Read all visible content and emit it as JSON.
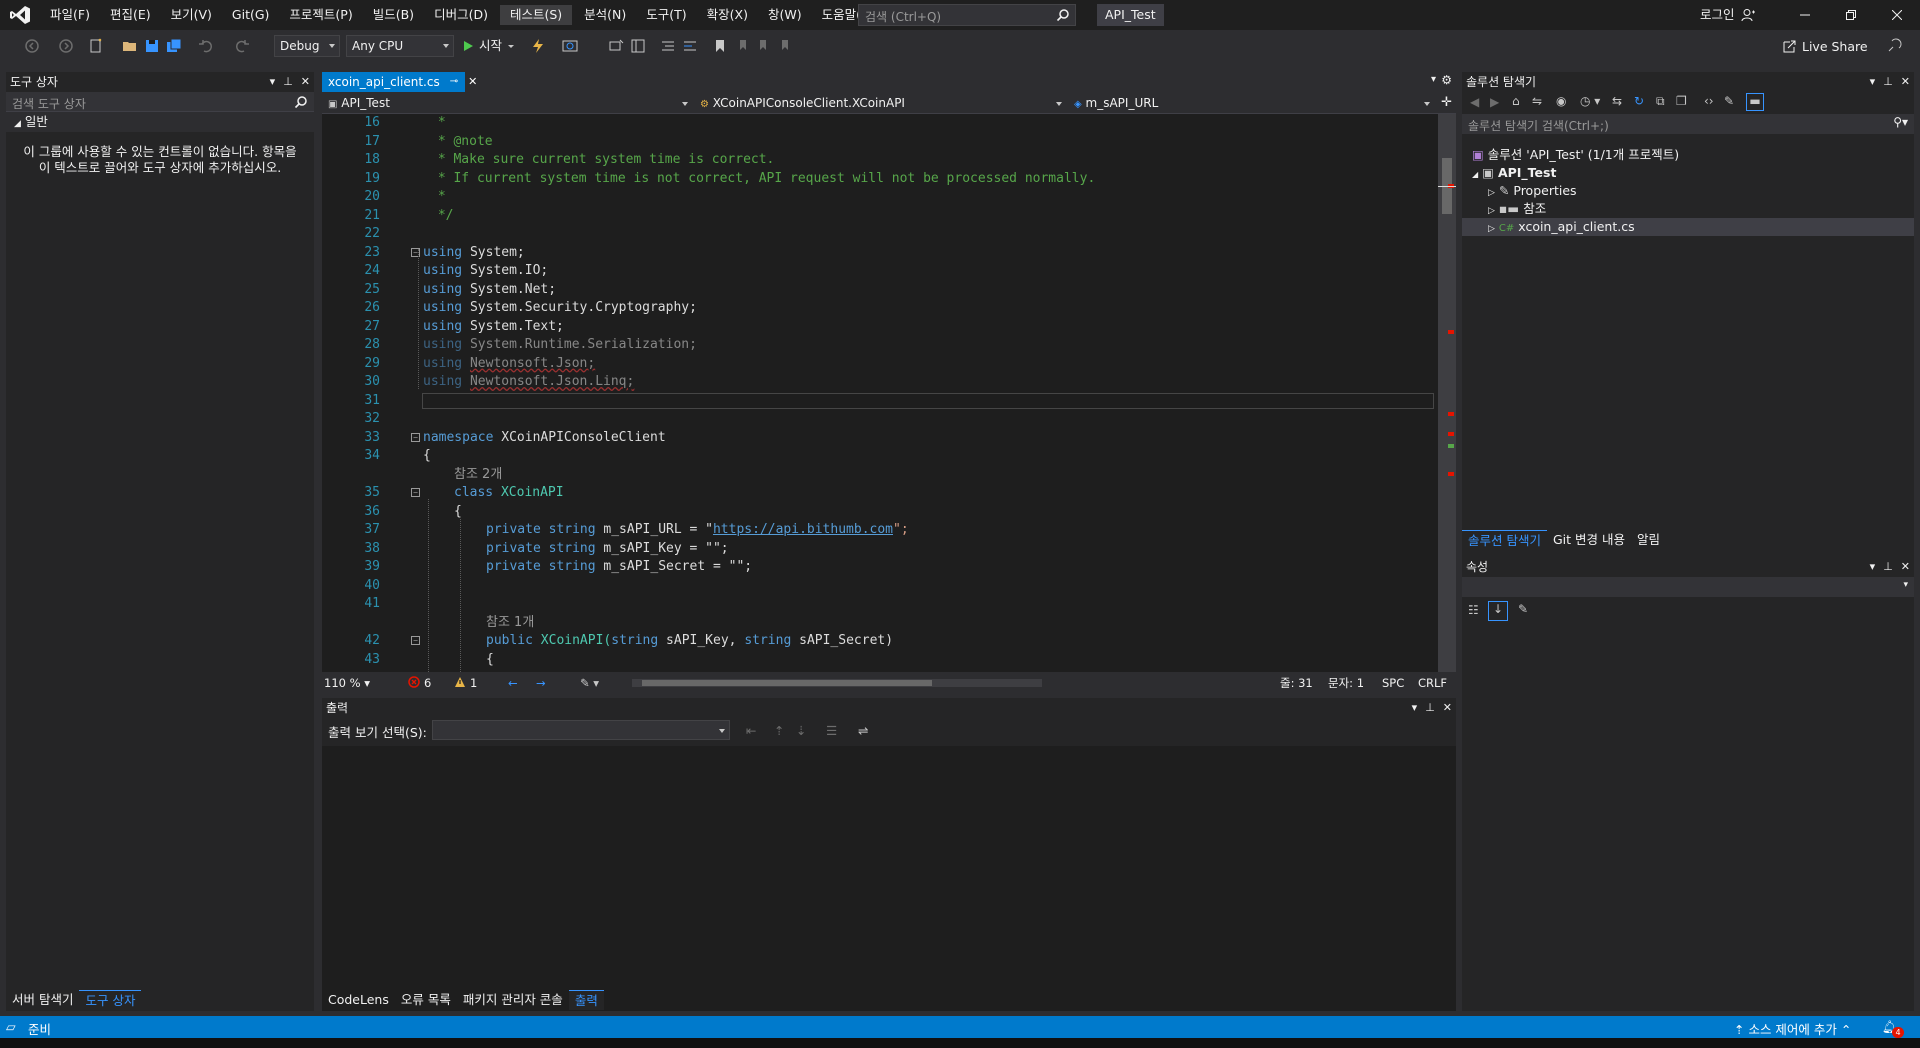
{
  "app": {
    "solution_title": "API_Test",
    "login_label": "로그인"
  },
  "menu": [
    "파일(F)",
    "편집(E)",
    "보기(V)",
    "Git(G)",
    "프로젝트(P)",
    "빌드(B)",
    "디버그(D)",
    "테스트(S)",
    "분석(N)",
    "도구(T)",
    "확장(X)",
    "창(W)",
    "도움말(H)"
  ],
  "search": {
    "placeholder": "검색 (Ctrl+Q)"
  },
  "toolbar": {
    "config": "Debug",
    "platform": "Any CPU",
    "start_label": "시작",
    "liveshare_label": "Live Share"
  },
  "toolbox": {
    "title": "도구 상자",
    "search_placeholder": "검색 도구 상자",
    "group": "일반",
    "empty_message": "이 그룹에 사용할 수 있는 컨트롤이 없습니다. 항목을 이 텍스트로 끌어와 도구 상자에 추가하십시오.",
    "tabs": [
      "서버 탐색기",
      "도구 상자"
    ]
  },
  "editor": {
    "tab_label": "xcoin_api_client.cs",
    "nav_project": "API_Test",
    "nav_class": "XCoinAPIConsoleClient.XCoinAPI",
    "nav_member": "m_sAPI_URL",
    "zoom": "110 %",
    "errors": "6",
    "warnings": "1",
    "line": "줄: 31",
    "col": "문자: 1",
    "spc": "SPC",
    "crlf": "CRLF",
    "lines": [
      {
        "n": "16",
        "text": " *"
      },
      {
        "n": "17",
        "text": " * @note"
      },
      {
        "n": "18",
        "text": " * Make sure current system time is correct."
      },
      {
        "n": "19",
        "text": " * If current system time is not correct, API request will not be processed normally."
      },
      {
        "n": "20",
        "text": " *"
      },
      {
        "n": "21",
        "text": " */"
      },
      {
        "n": "22",
        "text": ""
      },
      {
        "n": "23",
        "kw": "using",
        "rest": "System;"
      },
      {
        "n": "24",
        "kw": "using",
        "rest": "System.IO;"
      },
      {
        "n": "25",
        "kw": "using",
        "rest": "System.Net;"
      },
      {
        "n": "26",
        "kw": "using",
        "rest": "System.Security.Cryptography;"
      },
      {
        "n": "27",
        "kw": "using",
        "rest": "System.Text;"
      },
      {
        "n": "28",
        "kw": "using",
        "rest": "System.Runtime.Serialization;"
      },
      {
        "n": "29",
        "kw": "using",
        "rest": "Newtonsoft.Json;"
      },
      {
        "n": "30",
        "kw": "using",
        "rest": "Newtonsoft.Json.Linq;"
      },
      {
        "n": "31",
        "text": ""
      },
      {
        "n": "32",
        "text": ""
      },
      {
        "n": "33",
        "kw": "namespace",
        "rest": "XCoinAPIConsoleClient"
      },
      {
        "n": "34",
        "text": "{"
      },
      {
        "n": "35",
        "kw": "class",
        "rest": "XCoinAPI"
      },
      {
        "n": "36",
        "text": "{"
      },
      {
        "n": "37",
        "kw": "private string",
        "rest": "m_sAPI_URL = \"",
        "link": "https://api.bithumb.com",
        "tail": "\";"
      },
      {
        "n": "38",
        "kw": "private string",
        "rest": "m_sAPI_Key = \"\";"
      },
      {
        "n": "39",
        "kw": "private string",
        "rest": "m_sAPI_Secret = \"\";"
      },
      {
        "n": "40",
        "text": ""
      },
      {
        "n": "41",
        "text": ""
      },
      {
        "n": "42",
        "kw": "public",
        "rest": "XCoinAPI(",
        "p1t": "string",
        "p1": "sAPI_Key,",
        "p2t": "string",
        "p2": "sAPI_Secret)"
      },
      {
        "n": "43",
        "text": "{"
      }
    ],
    "codelens_2": "참조 2개",
    "codelens_1": "참조 1개"
  },
  "output": {
    "title": "출력",
    "show_from_label": "출력 보기 선택(S):",
    "tabs": [
      "CodeLens",
      "오류 목록",
      "패키지 관리자 콘솔",
      "출력"
    ]
  },
  "solution_explorer": {
    "title": "솔루션 탐색기",
    "search_placeholder": "솔루션 탐색기 검색(Ctrl+;)",
    "solution_node": "솔루션 'API_Test' (1/1개 프로젝트)",
    "project_node": "API_Test",
    "children": [
      "Properties",
      "참조",
      "xcoin_api_client.cs"
    ],
    "tabs": [
      "솔루션 탐색기",
      "Git 변경 내용",
      "알림"
    ]
  },
  "properties": {
    "title": "속성"
  },
  "statusbar": {
    "ready": "준비",
    "source_control": "소스 제어에 추가",
    "notif_count": "4"
  }
}
